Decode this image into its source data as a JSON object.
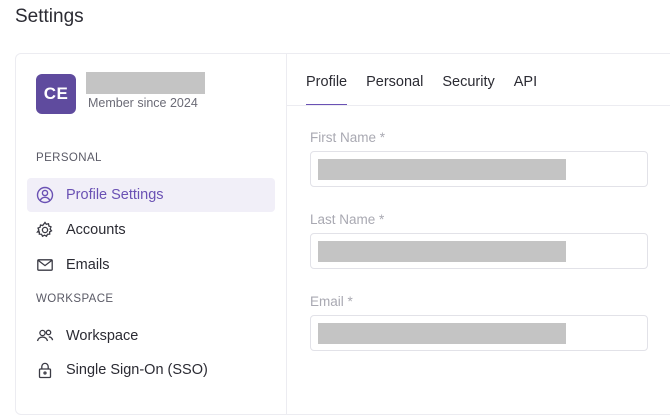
{
  "page": {
    "title": "Settings"
  },
  "user": {
    "initials": "CE",
    "member_since": "Member since 2024"
  },
  "sidebar": {
    "sections": [
      {
        "label": "PERSONAL",
        "items": [
          {
            "label": "Profile Settings",
            "icon": "user-circle-icon",
            "active": true
          },
          {
            "label": "Accounts",
            "icon": "gear-icon",
            "active": false
          },
          {
            "label": "Emails",
            "icon": "envelope-icon",
            "active": false
          }
        ]
      },
      {
        "label": "WORKSPACE",
        "items": [
          {
            "label": "Workspace",
            "icon": "users-icon",
            "active": false
          },
          {
            "label": "Single Sign-On (SSO)",
            "icon": "lock-icon",
            "active": false
          }
        ]
      }
    ]
  },
  "tabs": [
    {
      "label": "Profile",
      "active": true
    },
    {
      "label": "Personal",
      "active": false
    },
    {
      "label": "Security",
      "active": false
    },
    {
      "label": "API",
      "active": false
    }
  ],
  "form": {
    "fields": [
      {
        "label": "First Name *"
      },
      {
        "label": "Last Name *"
      },
      {
        "label": "Email *"
      }
    ]
  },
  "colors": {
    "accent": "#6a51b4",
    "avatar": "#5f4b9e",
    "active_bg": "#f1eff8"
  }
}
